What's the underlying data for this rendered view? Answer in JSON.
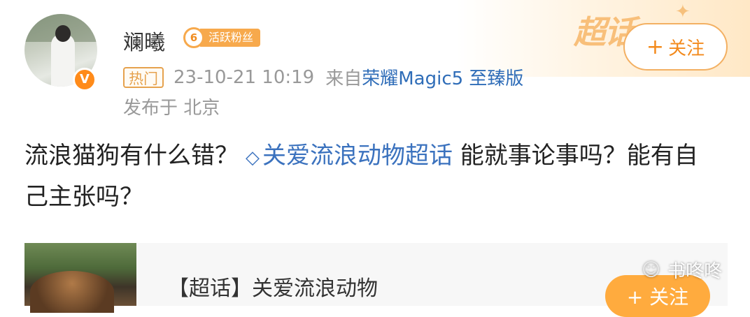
{
  "header": {
    "username": "斓曦",
    "level_number": "6",
    "level_label": "活跃粉丝",
    "hot_tag": "热门",
    "timestamp": "23-10-21 10:19",
    "source_prefix": "来自",
    "device": "荣耀Magic5 至臻版",
    "location": "发布于 北京",
    "follow_label": "关注",
    "follow_plus": "+",
    "corner_mark": "超话"
  },
  "post": {
    "text_before": "流浪猫狗有什么错？",
    "topic": "关爱流浪动物超话",
    "text_after": " 能就事论事吗？能有自己主张吗？"
  },
  "card": {
    "title": "【超话】关爱流浪动物",
    "follow_label": "+ 关注"
  },
  "watermark": {
    "text": "书咚咚"
  },
  "colors": {
    "accent_orange": "#f38a1c",
    "link_blue": "#3b72be",
    "meta_gray": "#999999"
  },
  "icons": {
    "verify": "verified-badge-icon",
    "topic": "diamond-topic-icon",
    "watermark": "wechat-icon"
  }
}
